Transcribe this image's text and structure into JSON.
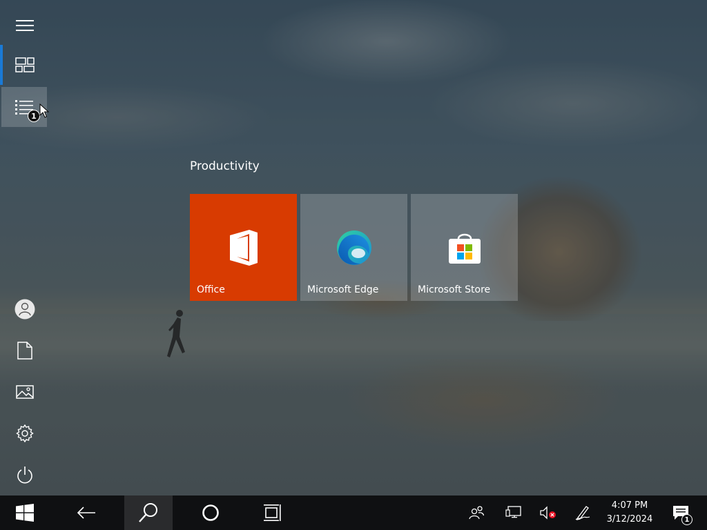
{
  "start_menu": {
    "group": {
      "title": "Productivity",
      "tiles": [
        {
          "label": "Office",
          "icon": "office-icon"
        },
        {
          "label": "Microsoft Edge",
          "icon": "edge-icon"
        },
        {
          "label": "Microsoft Store",
          "icon": "store-icon"
        }
      ]
    },
    "rail": {
      "items": [
        {
          "icon": "hamburger-icon"
        },
        {
          "icon": "tiles-icon",
          "active": true
        },
        {
          "icon": "all-apps-icon",
          "badge": "1",
          "hovered": true
        },
        {
          "icon": "user-icon"
        },
        {
          "icon": "documents-icon"
        },
        {
          "icon": "pictures-icon"
        },
        {
          "icon": "settings-icon"
        },
        {
          "icon": "power-icon"
        }
      ]
    }
  },
  "taskbar": {
    "buttons": [
      {
        "icon": "windows-icon"
      },
      {
        "icon": "back-arrow-icon"
      },
      {
        "icon": "search-icon",
        "active": true
      },
      {
        "icon": "cortana-icon"
      },
      {
        "icon": "task-view-icon"
      }
    ],
    "tray": [
      {
        "icon": "people-icon"
      },
      {
        "icon": "network-icon"
      },
      {
        "icon": "volume-muted-icon"
      },
      {
        "icon": "pen-icon"
      }
    ],
    "clock": {
      "time": "4:07 PM",
      "date": "3/12/2024"
    },
    "notifications": {
      "icon": "action-center-icon",
      "badge": "1"
    }
  },
  "colors": {
    "accent": "#1a7ad6",
    "office_tile": "#d83b01",
    "taskbar": "#0f1012"
  }
}
